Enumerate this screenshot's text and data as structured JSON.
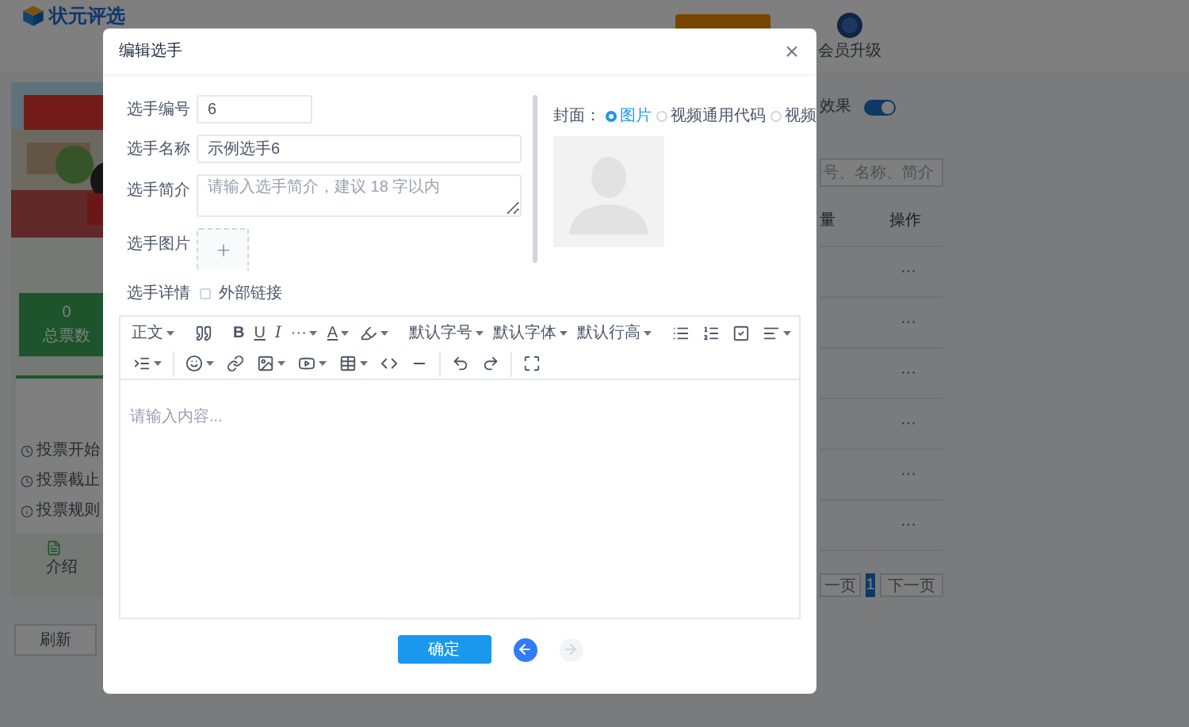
{
  "app": {
    "logo": "状元评选",
    "vip_label": "会员升级"
  },
  "preview": {
    "stat": {
      "value": "0",
      "label": "总票数"
    },
    "info": [
      "投票开始",
      "投票截止",
      "投票规则"
    ],
    "tab": "介绍",
    "refresh": "刷新"
  },
  "panel": {
    "effect_label": "效果",
    "effect_on": true,
    "search_placeholder": "号、名称、简介",
    "columns": [
      "量",
      "操作"
    ],
    "rows": [
      "···",
      "···",
      "···",
      "···",
      "···",
      "···"
    ],
    "pagination": {
      "prev": "一页",
      "pages": [
        {
          "label": "1",
          "selected": true
        }
      ],
      "next": "下一页"
    }
  },
  "dialog": {
    "title": "编辑选手",
    "number": {
      "label": "选手编号",
      "value": "6"
    },
    "name": {
      "label": "选手名称",
      "value": "示例选手6"
    },
    "intro": {
      "label": "选手简介",
      "placeholder": "请输入选手简介，建议 18 字以内"
    },
    "image": {
      "label": "选手图片"
    },
    "detail": {
      "label": "选手详情",
      "option": "外部链接",
      "checked": false
    },
    "cover": {
      "label": "封面：",
      "options": [
        {
          "label": "图片",
          "selected": true
        },
        {
          "label": "视频通用代码",
          "selected": false
        },
        {
          "label": "视频",
          "selected": false
        }
      ]
    },
    "toolbar": {
      "paragraph": "正文",
      "bold": "B",
      "underline": "U",
      "italic": "I",
      "more": "···",
      "font_color_letter": "A",
      "size": "默认字号",
      "font": "默认字体",
      "line_height": "默认行高"
    },
    "editor_placeholder": "请输入内容...",
    "confirm": "确定",
    "back_enabled": true,
    "forward_enabled": false
  }
}
